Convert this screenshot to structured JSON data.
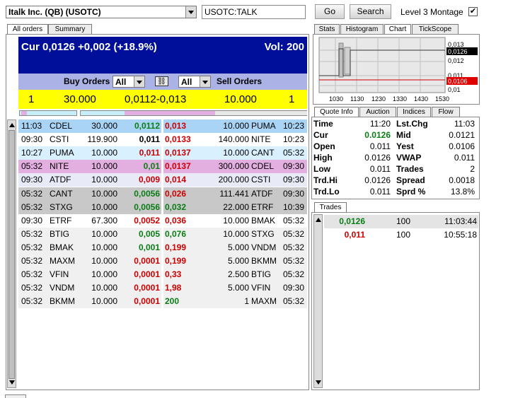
{
  "symbol_select": {
    "value": "Italk Inc. (QB) (USOTC)"
  },
  "symbol_input": {
    "value": "USOTC:TALK"
  },
  "buttons": {
    "go": "Go",
    "search": "Search"
  },
  "level3": {
    "label": "Level 3 Montage",
    "checked": true
  },
  "left_tabs": [
    "All orders",
    "Summary"
  ],
  "header": {
    "cur": "Cur 0,0126 +0,002 (+18.9%)",
    "vol": "Vol: 200"
  },
  "filter": {
    "buy_label": "Buy Orders",
    "buy_value": "All",
    "sell_value": "All",
    "sell_label": "Sell Orders"
  },
  "summary_bar": {
    "buy_count": "1",
    "buy_size": "30.000",
    "prices": "0,0112-0,013",
    "sell_size": "10.000",
    "sell_count": "1"
  },
  "buy_orders": [
    {
      "time": "11:03",
      "mm": "CDEL",
      "size": "30.000",
      "price": "0,0112",
      "pc": "g"
    },
    {
      "time": "09:30",
      "mm": "CSTI",
      "size": "119.900",
      "price": "0,011",
      "pc": "bk"
    },
    {
      "time": "10:27",
      "mm": "PUMA",
      "size": "10.000",
      "price": "0,011",
      "pc": "rd"
    },
    {
      "time": "05:32",
      "mm": "NITE",
      "size": "10.000",
      "price": "0,01",
      "pc": "g"
    },
    {
      "time": "09:30",
      "mm": "ATDF",
      "size": "10.000",
      "price": "0,009",
      "pc": "rd"
    },
    {
      "time": "05:32",
      "mm": "CANT",
      "size": "10.000",
      "price": "0,0056",
      "pc": "g"
    },
    {
      "time": "05:32",
      "mm": "STXG",
      "size": "10.000",
      "price": "0,0056",
      "pc": "g"
    },
    {
      "time": "09:30",
      "mm": "ETRF",
      "size": "67.300",
      "price": "0,0052",
      "pc": "rd"
    },
    {
      "time": "05:32",
      "mm": "BTIG",
      "size": "10.000",
      "price": "0,005",
      "pc": "g"
    },
    {
      "time": "05:32",
      "mm": "BMAK",
      "size": "10.000",
      "price": "0,001",
      "pc": "g"
    },
    {
      "time": "05:32",
      "mm": "MAXM",
      "size": "10.000",
      "price": "0,0001",
      "pc": "rd"
    },
    {
      "time": "05:32",
      "mm": "VFIN",
      "size": "10.000",
      "price": "0,0001",
      "pc": "rd"
    },
    {
      "time": "05:32",
      "mm": "VNDM",
      "size": "10.000",
      "price": "0,0001",
      "pc": "rd"
    },
    {
      "time": "05:32",
      "mm": "BKMM",
      "size": "10.000",
      "price": "0,0001",
      "pc": "rd"
    }
  ],
  "sell_orders": [
    {
      "price": "0,013",
      "pc": "rd",
      "size": "10.000",
      "mm": "PUMA",
      "time": "10:23"
    },
    {
      "price": "0,0133",
      "pc": "rd",
      "size": "140.000",
      "mm": "NITE",
      "time": "10:23"
    },
    {
      "price": "0,0137",
      "pc": "rd",
      "size": "10.000",
      "mm": "CANT",
      "time": "05:32"
    },
    {
      "price": "0,0137",
      "pc": "rd",
      "size": "300.000",
      "mm": "CDEL",
      "time": "09:30"
    },
    {
      "price": "0,014",
      "pc": "rd",
      "size": "200.000",
      "mm": "CSTI",
      "time": "09:30"
    },
    {
      "price": "0,026",
      "pc": "rd",
      "size": "111.441",
      "mm": "ATDF",
      "time": "09:30"
    },
    {
      "price": "0,032",
      "pc": "g",
      "size": "22.000",
      "mm": "ETRF",
      "time": "10:39"
    },
    {
      "price": "0,036",
      "pc": "rd",
      "size": "10.000",
      "mm": "BMAK",
      "time": "05:32"
    },
    {
      "price": "0,076",
      "pc": "g",
      "size": "10.000",
      "mm": "STXG",
      "time": "05:32"
    },
    {
      "price": "0,199",
      "pc": "rd",
      "size": "5.000",
      "mm": "VNDM",
      "time": "05:32"
    },
    {
      "price": "0,199",
      "pc": "rd",
      "size": "5.000",
      "mm": "BKMM",
      "time": "05:32"
    },
    {
      "price": "0,33",
      "pc": "rd",
      "size": "2.500",
      "mm": "BTIG",
      "time": "05:32"
    },
    {
      "price": "1,98",
      "pc": "rd",
      "size": "5.000",
      "mm": "VFIN",
      "time": "09:30"
    },
    {
      "price": "200",
      "pc": "g",
      "size": "1",
      "mm": "MAXM",
      "time": "05:32"
    }
  ],
  "row_colors": [
    "#aad4f5",
    "#ffffff",
    "#d8f0ff",
    "#e3aee0",
    "#e8eaf8",
    "#c8c8c8",
    "#c8c8c8",
    "#ffffff",
    "#f0f0f0",
    "#f0f0f0",
    "#f0f0f0",
    "#f0f0f0",
    "#f0f0f0",
    "#f0f0f0"
  ],
  "chart_tabs": [
    "Stats",
    "Histogram",
    "Chart",
    "TickScope"
  ],
  "chart": {
    "x_ticks": [
      "1030",
      "1130",
      "1230",
      "1330",
      "1430",
      "1530"
    ],
    "y_ticks": [
      "0,013",
      "0,0126",
      "0,012",
      "0,011",
      "0,0106",
      "0,01"
    ]
  },
  "quote_tabs": [
    "Quote Info",
    "Auction",
    "Indices",
    "Flow"
  ],
  "quote_info": [
    {
      "l1": "Time",
      "v1": "11:20",
      "l2": "Lst.Chg",
      "v2": "11:03"
    },
    {
      "l1": "Cur",
      "v1": "0.0126",
      "l2": "Mid",
      "v2": "0.0121"
    },
    {
      "l1": "Open",
      "v1": "0.011",
      "l2": "Yest",
      "v2": "0.0106"
    },
    {
      "l1": "High",
      "v1": "0.0126",
      "l2": "VWAP",
      "v2": "0.011"
    },
    {
      "l1": "Low",
      "v1": "0.011",
      "l2": "Trades",
      "v2": "2"
    },
    {
      "l1": "Trd.Hi",
      "v1": "0.0126",
      "l2": "Spread",
      "v2": "0.0018"
    },
    {
      "l1": "Trd.Lo",
      "v1": "0.011",
      "l2": "Sprd %",
      "v2": "13.8%"
    }
  ],
  "trades_tab": "Trades",
  "trades": [
    {
      "price": "0,0126",
      "pc": "g",
      "size": "100",
      "time": "11:03:44"
    },
    {
      "price": "0,011",
      "pc": "rd",
      "size": "100",
      "time": "10:55:18"
    }
  ],
  "colors": {
    "header_bg": "#000f99",
    "filter_bg": "#aab2e6",
    "summary_bg": "#ffff00",
    "green": "#0a7d14",
    "red": "#cc0000"
  }
}
